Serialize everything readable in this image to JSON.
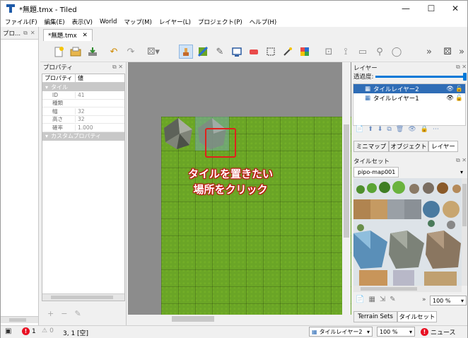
{
  "window": {
    "title": "*無題.tmx - Tiled",
    "minimize": "—",
    "maximize": "☐",
    "close": "✕"
  },
  "menu": [
    "ファイル(F)",
    "編集(E)",
    "表示(V)",
    "World",
    "マップ(M)",
    "レイヤー(L)",
    "プロジェクト(P)",
    "ヘルプ(H)"
  ],
  "left_dock": {
    "title": "プロ..."
  },
  "doc_tab": {
    "label": "*無題.tmx",
    "close": "✕"
  },
  "properties": {
    "title": "プロパティ",
    "col_property": "プロパティ",
    "col_value": "値",
    "group_tile": "タイル",
    "rows": [
      {
        "key": "ID",
        "value": "41"
      },
      {
        "key": "種類",
        "value": ""
      },
      {
        "key": "幅",
        "value": "32"
      },
      {
        "key": "高さ",
        "value": "32"
      },
      {
        "key": "確率",
        "value": "1.000"
      }
    ],
    "group_custom": "カスタムプロパティ"
  },
  "annotation": {
    "line1": "タイルを置きたい",
    "line2": "場所をクリック"
  },
  "layers_panel": {
    "title": "レイヤー",
    "opacity_label": "透過度:",
    "opacity": 1.0,
    "layers": [
      {
        "name": "タイルレイヤー2",
        "selected": true
      },
      {
        "name": "タイルレイヤー1",
        "selected": false
      }
    ],
    "tabs": [
      "ミニマップ",
      "オブジェクト",
      "レイヤー"
    ]
  },
  "tileset_panel": {
    "title": "タイルセット",
    "tab": "pipo-map001",
    "zoom": "100 %",
    "bottom_tabs": [
      "Terrain Sets",
      "タイルセット"
    ]
  },
  "status": {
    "error_count": "1",
    "warning_count": "0",
    "coords": "3, 1 [空]",
    "layer_select": "タイルレイヤー2",
    "zoom": "100 %",
    "news": "ニュース"
  },
  "colors": {
    "accent": "#0078d7",
    "grass": "#6aa526",
    "highlight": "#e0211d",
    "annotation_text": "#ffffff",
    "error": "#e81123"
  }
}
